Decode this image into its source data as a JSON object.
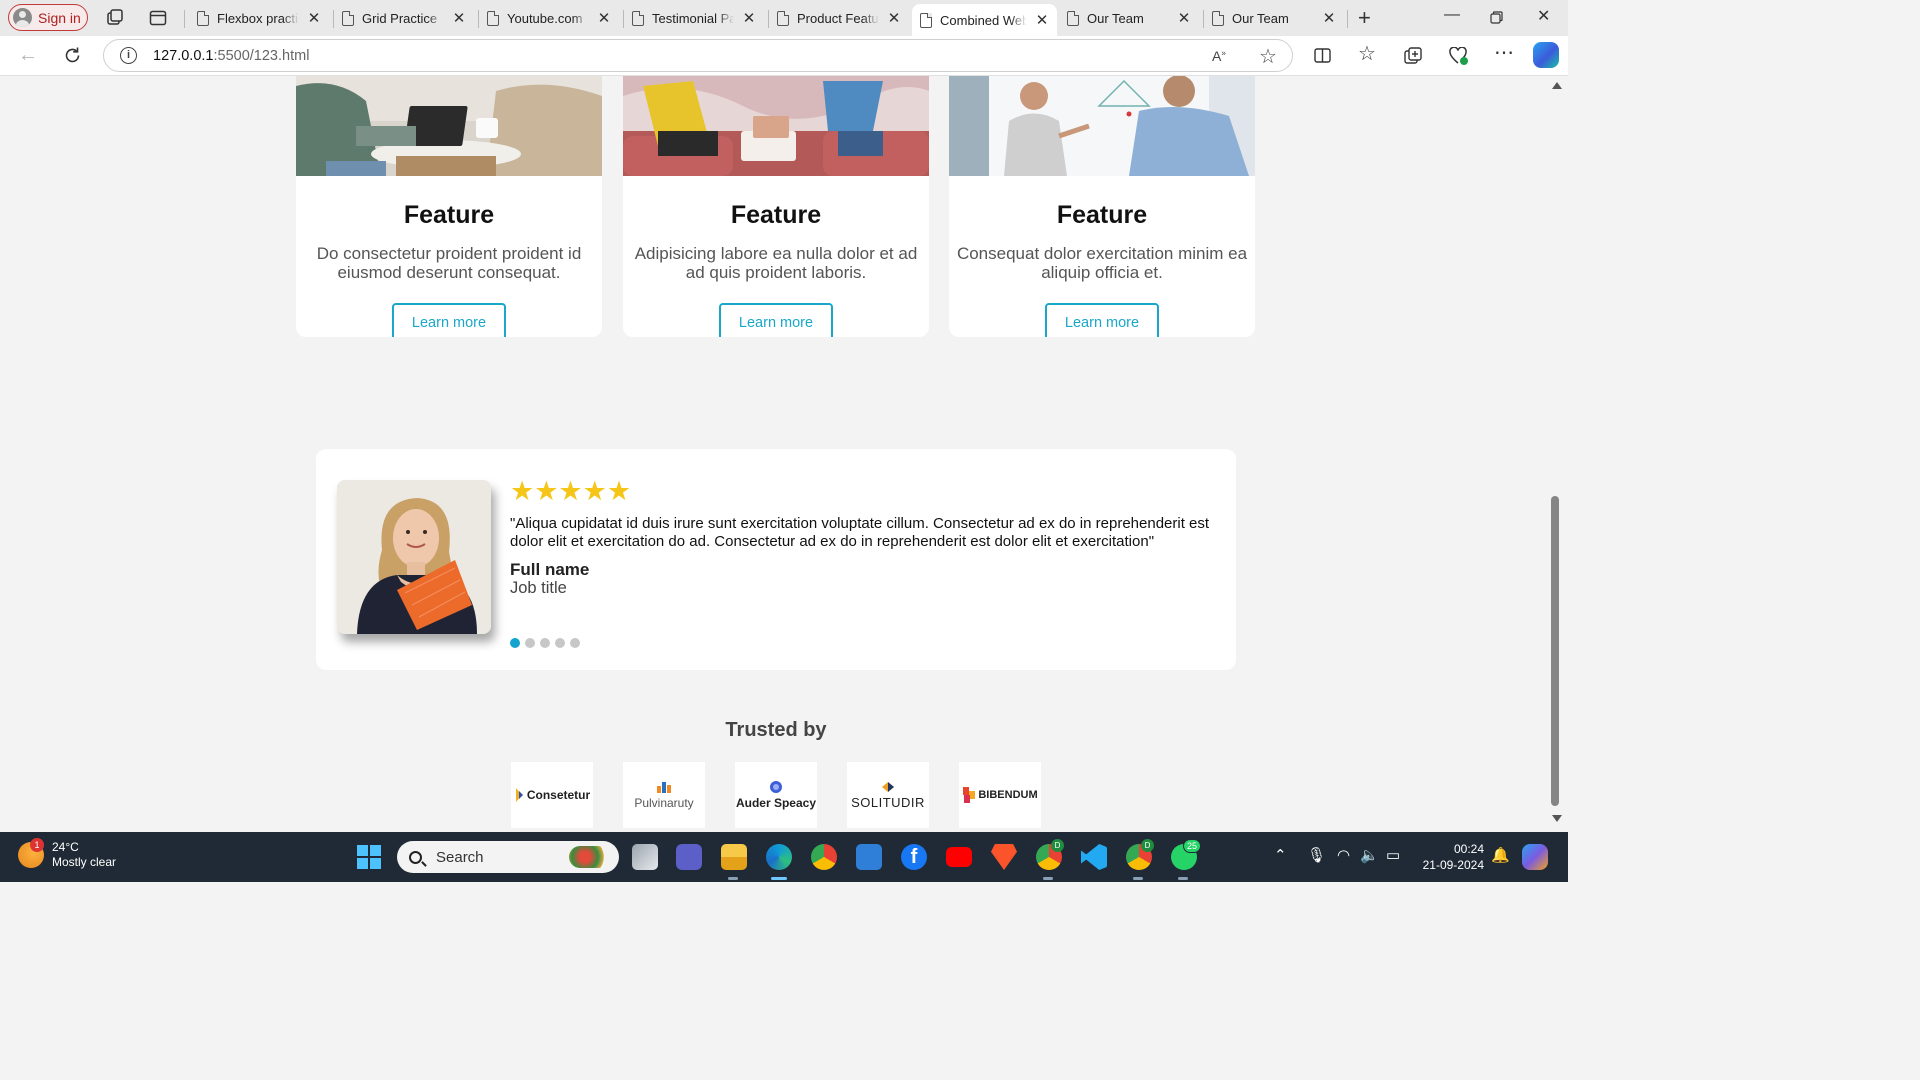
{
  "browser": {
    "signin_label": "Sign in",
    "tabs": [
      {
        "title": "Flexbox practice",
        "active": false
      },
      {
        "title": "Grid Practice",
        "active": false
      },
      {
        "title": "Youtube.com",
        "active": false
      },
      {
        "title": "Testimonial Page",
        "active": false
      },
      {
        "title": "Product Features",
        "active": false
      },
      {
        "title": "Combined Web",
        "active": true
      },
      {
        "title": "Our Team",
        "active": false
      },
      {
        "title": "Our Team",
        "active": false
      }
    ],
    "url_host": "127.0.0.1",
    "url_path": ":5500/123.html"
  },
  "features": {
    "cards": [
      {
        "title": "Feature",
        "text": "Do consectetur proident proident id eiusmod deserunt consequat.",
        "button": "Learn more"
      },
      {
        "title": "Feature",
        "text": "Adipisicing labore ea nulla dolor et ad ad quis proident laboris.",
        "button": "Learn more"
      },
      {
        "title": "Feature",
        "text": "Consequat dolor exercitation minim ea aliquip officia et.",
        "button": "Learn more"
      }
    ]
  },
  "testimonial": {
    "rating": 5,
    "stars": "★★★★★",
    "quote": "\"Aliqua cupidatat id duis irure sunt exercitation voluptate cillum. Consectetur ad ex do in reprehenderit est dolor elit et exercitation do ad. Consectetur ad ex do in reprehenderit est dolor elit et exercitation\"",
    "name": "Full name",
    "job": "Job title",
    "slide_count": 5,
    "active_slide": 1
  },
  "trusted": {
    "heading": "Trusted by",
    "logos": [
      "Consetetur",
      "Pulvinaruty",
      "Auder Speacy",
      "SOLITUDIR",
      "BIBENDUM"
    ]
  },
  "taskbar": {
    "weather_badge": "1",
    "temperature": "24°C",
    "condition": "Mostly clear",
    "search_label": "Search",
    "time": "00:24",
    "date": "21-09-2024",
    "chrome_badge_1": "D",
    "chrome_badge_2": "D",
    "whatsapp_badge": "25"
  },
  "colors": {
    "accent": "#1aa7c9",
    "star": "#f5c518",
    "page_bg": "#f3f3f3",
    "taskbar_bg": "#1f2a36"
  }
}
